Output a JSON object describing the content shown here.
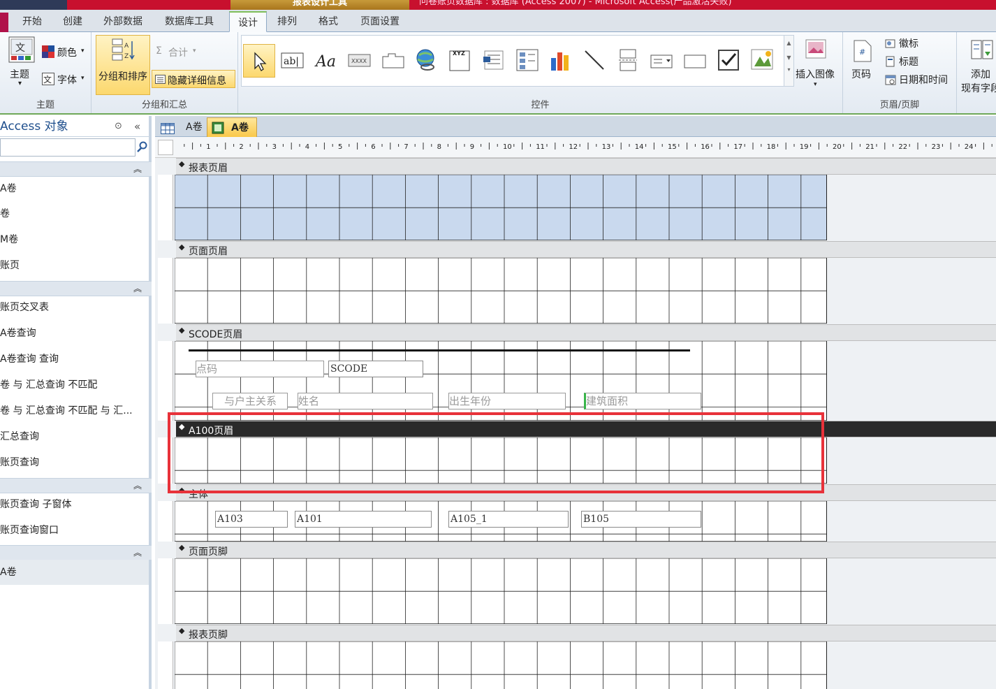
{
  "title": {
    "context_tab": "报表设计工具",
    "window_title": "问卷账页数据库 : 数据库 (Access 2007) - Microsoft Access(产品激活失败)"
  },
  "tabs": [
    "开始",
    "创建",
    "外部数据",
    "数据库工具",
    "设计",
    "排列",
    "格式",
    "页面设置"
  ],
  "active_tab": "设计",
  "ribbon": {
    "theme_group": {
      "label": "主题",
      "theme": "主题",
      "colors": "颜色",
      "fonts": "字体"
    },
    "group_sort": {
      "label": "分组和汇总",
      "group_sort": "分组和排序",
      "totals": "合计",
      "hide_details": "隐藏详细信息"
    },
    "controls": {
      "label": "控件",
      "insert_image": "插入图像"
    },
    "header_footer": {
      "label": "页眉/页脚",
      "page_numbers": "页码",
      "logo": "徽标",
      "title": "标题",
      "date_time": "日期和时间"
    },
    "add_fields": {
      "line1": "添加",
      "line2": "现有字段"
    }
  },
  "nav": {
    "header": "Access 对象",
    "items_tables": [
      "A卷",
      "卷",
      "M卷",
      "账页"
    ],
    "items_queries": [
      "账页交叉表",
      "A卷查询",
      "A卷查询 查询",
      "卷 与 汇总查询 不匹配",
      "卷 与 汇总查询 不匹配 与 汇...",
      "汇总查询",
      "账页查询"
    ],
    "items_forms": [
      "账页查询 子窗体",
      "账页查询窗口"
    ],
    "items_reports": [
      "A卷"
    ]
  },
  "doc_tabs": [
    "A卷",
    "A卷"
  ],
  "ruler_labels": [
    "1",
    "2",
    "3",
    "4",
    "5",
    "6",
    "7",
    "8",
    "9",
    "10",
    "11",
    "12",
    "13",
    "14",
    "15",
    "16",
    "17",
    "18",
    "19",
    "20",
    "21",
    "22",
    "23",
    "24"
  ],
  "sections": {
    "report_header": "报表页眉",
    "page_header": "页面页眉",
    "scode_header": "SCODE页眉",
    "a100_header": "A100页眉",
    "detail": "主体",
    "page_footer": "页面页脚",
    "report_footer": "报表页脚"
  },
  "scode_controls": {
    "label_dianma": "点码",
    "field_scode": "SCODE",
    "label_relation": "与户主关系",
    "label_name": "姓名",
    "label_birth": "出生年份",
    "label_area": "建筑面积"
  },
  "detail_controls": {
    "a103": "A103",
    "a101": "A101",
    "a105": "A105_1",
    "b105": "B105"
  },
  "colors": {
    "highlight": "#e8323a",
    "report_header_fill": "#c9d9ee",
    "ribbon_border": "#6fa858"
  }
}
